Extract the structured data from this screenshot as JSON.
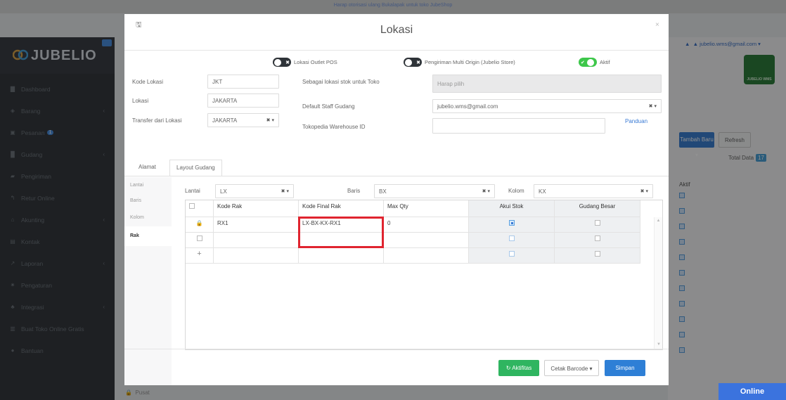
{
  "banner": "Harap otorisasi ulang Bukalapak untuk toko JubeShop",
  "app": {
    "logo_text": "JUBELIO",
    "user_email": "jubelio.wms@gmail.com",
    "wms_label": "JUBELIO WMS"
  },
  "sidebar": {
    "items": [
      {
        "label": "Dashboard",
        "icon": "chart-icon"
      },
      {
        "label": "Barang",
        "icon": "cubes-icon"
      },
      {
        "label": "Pesanan",
        "icon": "cart-icon",
        "badge": "1"
      },
      {
        "label": "Gudang",
        "icon": "warehouse-icon"
      },
      {
        "label": "Pengiriman",
        "icon": "truck-icon"
      },
      {
        "label": "Retur Online",
        "icon": "return-icon"
      },
      {
        "label": "Akunting",
        "icon": "bank-icon"
      },
      {
        "label": "Kontak",
        "icon": "contact-icon"
      },
      {
        "label": "Laporan",
        "icon": "report-icon"
      },
      {
        "label": "Pengaturan",
        "icon": "gears-icon"
      },
      {
        "label": "Integrasi",
        "icon": "integration-icon"
      },
      {
        "label": "Buat Toko Online Gratis",
        "icon": "store-icon"
      },
      {
        "label": "Bantuan",
        "icon": "help-icon"
      }
    ]
  },
  "background": {
    "tambah_baru": "Tambah Baru",
    "refresh": "Refresh",
    "total_data_label": "Total Data",
    "total_data_value": "17",
    "aktif_header": "Aktif",
    "pusat_label": "Pusat",
    "online_label": "Online"
  },
  "modal": {
    "title": "Lokasi",
    "toggles": [
      {
        "label": "Lokasi Outlet POS",
        "state": "off"
      },
      {
        "label": "Pengiriman Multi Origin (Jubelio Store)",
        "state": "off"
      },
      {
        "label": "Aktif",
        "state": "on"
      }
    ],
    "fields": {
      "kode_lokasi_label": "Kode Lokasi",
      "kode_lokasi_value": "JKT",
      "lokasi_label": "Lokasi",
      "lokasi_value": "JAKARTA",
      "transfer_label": "Transfer dari Lokasi",
      "transfer_value": "JAKARTA",
      "stok_toko_label": "Sebagai lokasi stok untuk Toko",
      "stok_toko_placeholder": "Harap pilih",
      "staff_label": "Default Staff Gudang",
      "staff_value": "jubelio.wms@gmail.com",
      "tokopedia_label": "Tokopedia Warehouse ID",
      "panduan": "Panduan"
    },
    "tabs": [
      "Alamat",
      "Layout Gudang"
    ],
    "subnav": [
      "Lantai",
      "Baris",
      "Kolom",
      "Rak"
    ],
    "filters": {
      "lantai_label": "Lantai",
      "lantai_value": "LX",
      "baris_label": "Baris",
      "baris_value": "BX",
      "kolom_label": "Kolom",
      "kolom_value": "KX"
    },
    "grid": {
      "columns": [
        "Kode Rak",
        "Kode Final Rak",
        "Max Qty",
        "Akui Stok",
        "Gudang Besar"
      ],
      "rows": [
        {
          "kode_rak": "RX1",
          "kode_final": "LX-BX-KX-RX1",
          "max_qty": "0",
          "akui_stok": true,
          "gudang_besar": false
        }
      ]
    },
    "buttons": {
      "aktifitas": "Aktifitas",
      "cetak_barcode": "Cetak Barcode",
      "simpan": "Simpan"
    }
  }
}
